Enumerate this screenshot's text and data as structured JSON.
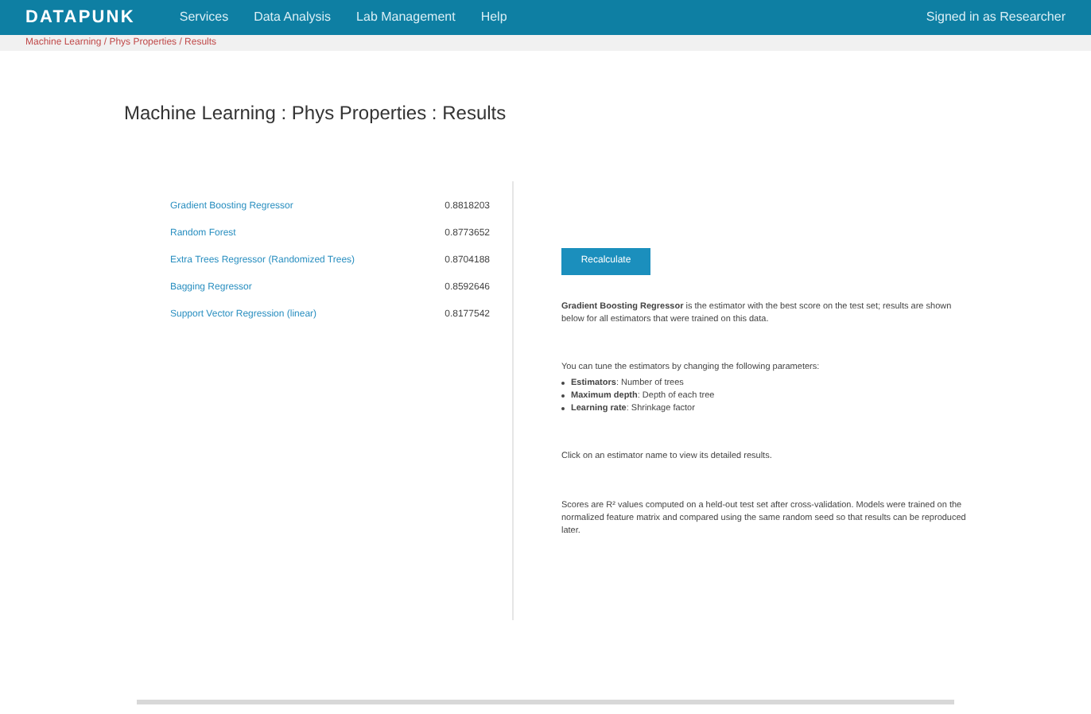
{
  "nav": {
    "logo": "DATAPUNK",
    "items": [
      "Services",
      "Data Analysis",
      "Lab Management",
      "Help"
    ],
    "user": "Signed in as Researcher"
  },
  "breadcrumb": "Machine Learning / Phys Properties / Results",
  "title": "Machine Learning : Phys Properties : Results",
  "results": [
    {
      "name": "Gradient Boosting Regressor",
      "value": "0.8818203"
    },
    {
      "name": "Random Forest",
      "value": "0.8773652"
    },
    {
      "name": "Extra Trees Regressor (Randomized Trees)",
      "value": "0.8704188"
    },
    {
      "name": "Bagging Regressor",
      "value": "0.8592646"
    },
    {
      "name": "Support Vector Regression (linear)",
      "value": "0.8177542"
    }
  ],
  "button": "Recalculate",
  "intro": "**Gradient Boosting Regressor** is the estimator with the best score on the test set; results are shown below for all estimators that were trained on this data.",
  "list_intro": "You can tune the estimators by changing the following parameters:",
  "bullets": [
    "**Estimators**: Number of trees",
    "**Maximum depth**: Depth of each tree",
    "**Learning rate**: Shrinkage factor"
  ],
  "note": "Click on an estimator name to view its detailed results.",
  "footer_text": "Scores are R² values computed on a held-out test set after cross-validation. Models were trained on the normalized feature matrix and compared using the same random seed so that results can be reproduced later."
}
